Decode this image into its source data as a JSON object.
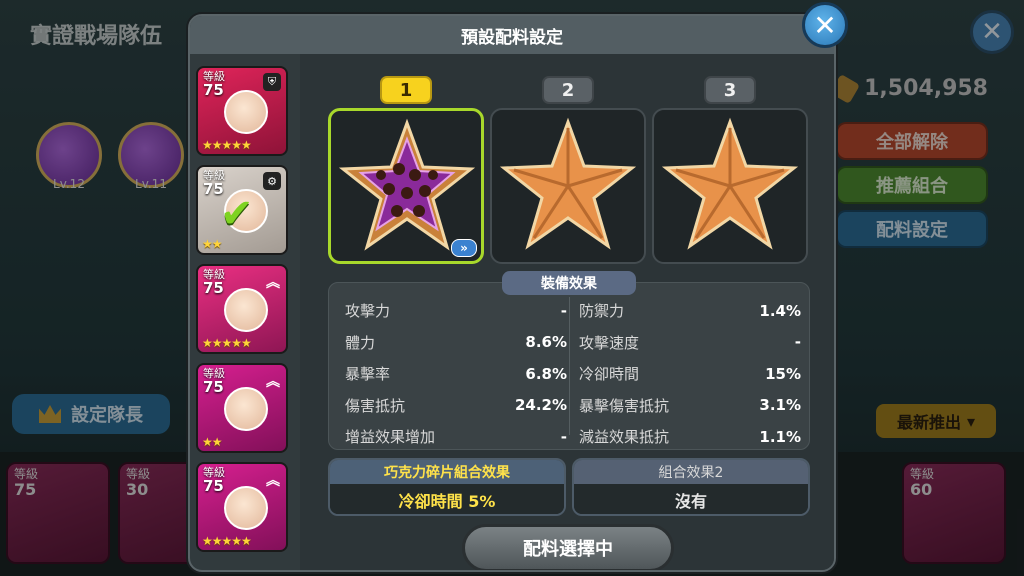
{
  "background": {
    "title": "實證戰場隊伍",
    "pets": [
      {
        "level": "Lv.12"
      },
      {
        "level": "Lv.11"
      }
    ],
    "coins": "1,504,958",
    "buttons": {
      "release_all": "全部解除",
      "recommend": "推薦組合",
      "config": "配料設定"
    },
    "leader_button": "設定隊長",
    "sort_button": "最新推出",
    "cards": [
      {
        "level_label": "等級",
        "level": "75"
      },
      {
        "level_label": "等級",
        "level": "30"
      },
      {
        "level_label": "等級",
        "level": "60"
      }
    ]
  },
  "modal": {
    "title": "預設配料設定",
    "presets": [
      {
        "label": "1",
        "selected": true
      },
      {
        "label": "2",
        "selected": false
      },
      {
        "label": "3",
        "selected": false
      }
    ],
    "more_icon": "double-chevron-right",
    "cookies": [
      {
        "level_label": "等級",
        "level": "75",
        "stars": "★★★★★",
        "badge": "shield-icon",
        "color": "red",
        "checked": false
      },
      {
        "level_label": "等級",
        "level": "75",
        "stars": "★★",
        "badge": "gear-icon",
        "color": "white",
        "checked": true
      },
      {
        "level_label": "等級",
        "level": "75",
        "stars": "★★★★★",
        "badge": "double-up-icon",
        "color": "pink",
        "checked": false
      },
      {
        "level_label": "等級",
        "level": "75",
        "stars": "★★",
        "badge": "double-up-icon",
        "color": "magenta",
        "checked": false
      },
      {
        "level_label": "等級",
        "level": "75",
        "stars": "★★★★★",
        "badge": "double-up-icon",
        "color": "magenta",
        "checked": false
      }
    ],
    "effects_title": "裝備效果",
    "stats_left": [
      {
        "name": "攻擊力",
        "value": "-"
      },
      {
        "name": "體力",
        "value": "8.6%"
      },
      {
        "name": "暴擊率",
        "value": "6.8%"
      },
      {
        "name": "傷害抵抗",
        "value": "24.2%"
      },
      {
        "name": "增益效果增加",
        "value": "-"
      }
    ],
    "stats_right": [
      {
        "name": "防禦力",
        "value": "1.4%"
      },
      {
        "name": "攻擊速度",
        "value": "-"
      },
      {
        "name": "冷卻時間",
        "value": "15%"
      },
      {
        "name": "暴擊傷害抵抗",
        "value": "3.1%"
      },
      {
        "name": "減益效果抵抗",
        "value": "1.1%"
      }
    ],
    "combo1": {
      "title": "巧克力碎片組合效果",
      "value": "冷卻時間 5%"
    },
    "combo2": {
      "title": "組合效果2",
      "value": "沒有"
    },
    "select_button": "配料選擇中"
  }
}
